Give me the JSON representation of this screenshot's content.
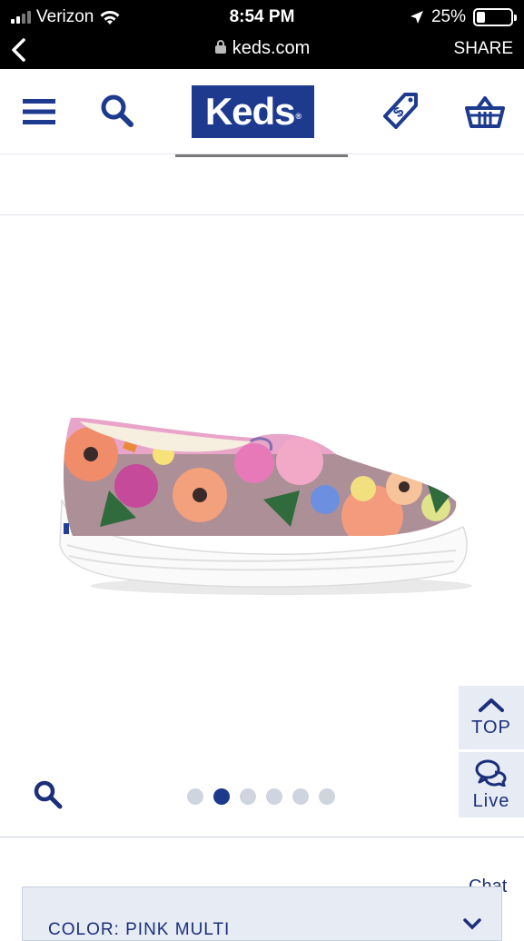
{
  "status_bar": {
    "carrier": "Verizon",
    "time": "8:54 PM",
    "battery": "25%"
  },
  "browser": {
    "url": "keds.com",
    "share_label": "SHARE"
  },
  "header": {
    "logo_text": "Keds"
  },
  "gallery": {
    "dot_count": 6,
    "active_index": 1
  },
  "floating": {
    "top_label": "TOP",
    "live_label": "Live",
    "chat_label": "Chat"
  },
  "product_options": {
    "color_label": "COLOR: PINK MULTI"
  },
  "colors": {
    "brand_blue": "#1d3a8f",
    "panel_blue": "#e6ebf4"
  }
}
